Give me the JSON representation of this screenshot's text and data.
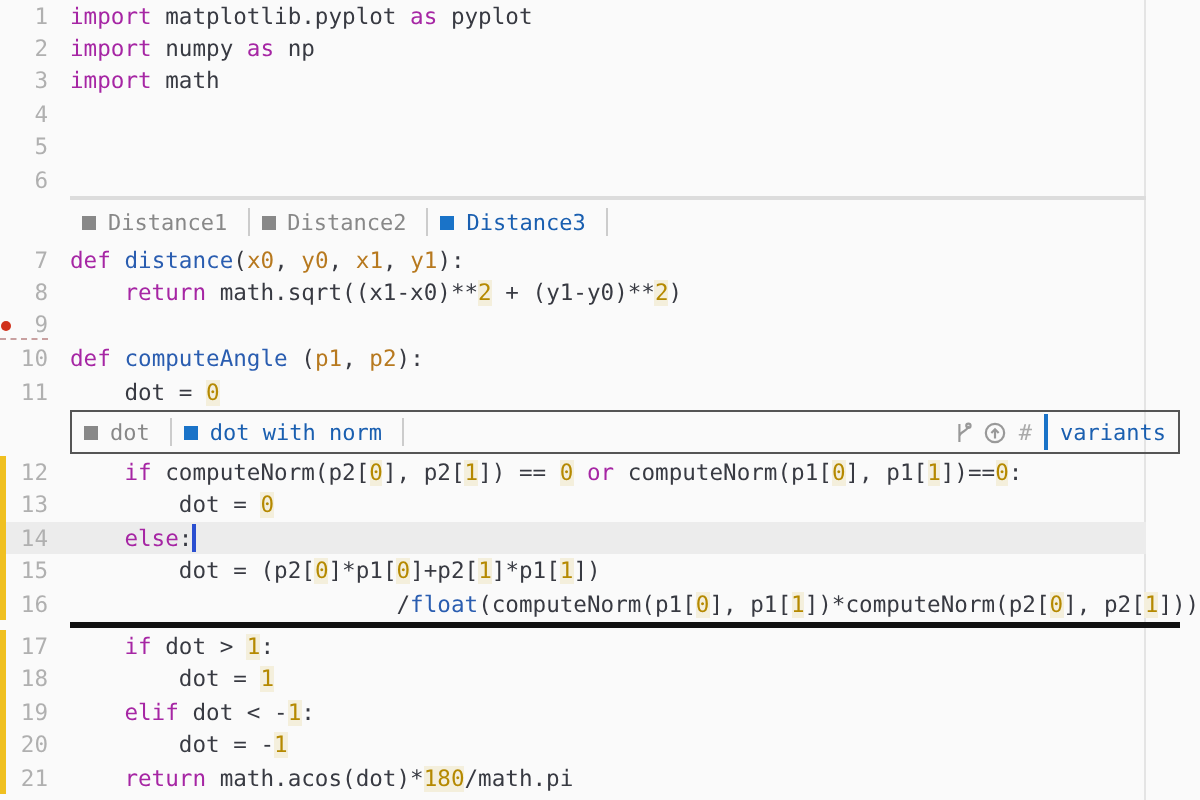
{
  "editor": {
    "blocks": [
      {
        "kind": "code",
        "lines": [
          {
            "number": "1",
            "changed": false,
            "current": false,
            "insertion": false,
            "tokens": [
              {
                "kind": "keyword",
                "text": "import"
              },
              {
                "kind": "plain",
                "text": " matplotlib.pyplot "
              },
              {
                "kind": "keyword",
                "text": "as"
              },
              {
                "kind": "plain",
                "text": " pyplot"
              }
            ]
          },
          {
            "number": "2",
            "changed": false,
            "current": false,
            "insertion": false,
            "tokens": [
              {
                "kind": "keyword",
                "text": "import"
              },
              {
                "kind": "plain",
                "text": " numpy "
              },
              {
                "kind": "keyword",
                "text": "as"
              },
              {
                "kind": "plain",
                "text": " np"
              }
            ]
          },
          {
            "number": "3",
            "changed": false,
            "current": false,
            "insertion": false,
            "tokens": [
              {
                "kind": "keyword",
                "text": "import"
              },
              {
                "kind": "plain",
                "text": " math"
              }
            ]
          },
          {
            "number": "4",
            "changed": false,
            "current": false,
            "insertion": false
          },
          {
            "number": "5",
            "changed": false,
            "current": false,
            "insertion": false
          },
          {
            "number": "6",
            "changed": false,
            "current": false,
            "insertion": false
          }
        ]
      },
      {
        "kind": "variant_bar",
        "bordered": false,
        "tabs": [
          {
            "label": "Distance1",
            "selected": false
          },
          {
            "label": "Distance2",
            "selected": false
          },
          {
            "label": "Distance3",
            "selected": true
          }
        ]
      },
      {
        "kind": "code",
        "lines": [
          {
            "number": "7",
            "changed": false,
            "current": false,
            "insertion": false,
            "tokens": [
              {
                "kind": "keyword",
                "text": "def "
              },
              {
                "kind": "function",
                "text": "distance"
              },
              {
                "kind": "plain",
                "text": "("
              },
              {
                "kind": "param",
                "text": "x0"
              },
              {
                "kind": "plain",
                "text": ", "
              },
              {
                "kind": "param",
                "text": "y0"
              },
              {
                "kind": "plain",
                "text": ", "
              },
              {
                "kind": "param",
                "text": "x1"
              },
              {
                "kind": "plain",
                "text": ", "
              },
              {
                "kind": "param",
                "text": "y1"
              },
              {
                "kind": "plain",
                "text": "):"
              }
            ]
          },
          {
            "number": "8",
            "changed": false,
            "current": false,
            "insertion": false,
            "tokens": [
              {
                "kind": "keyword",
                "text": "    return"
              },
              {
                "kind": "plain",
                "text": " math.sqrt((x1-x0)**"
              },
              {
                "kind": "number",
                "text": "2"
              },
              {
                "kind": "plain",
                "text": " + (y1-y0)**"
              },
              {
                "kind": "number",
                "text": "2"
              },
              {
                "kind": "plain",
                "text": ")"
              }
            ]
          },
          {
            "number": "9",
            "changed": false,
            "current": false,
            "insertion": true
          },
          {
            "number": "10",
            "changed": false,
            "current": false,
            "insertion": false,
            "tokens": [
              {
                "kind": "keyword",
                "text": "def "
              },
              {
                "kind": "function",
                "text": "computeAngle"
              },
              {
                "kind": "plain",
                "text": " ("
              },
              {
                "kind": "param",
                "text": "p1"
              },
              {
                "kind": "plain",
                "text": ", "
              },
              {
                "kind": "param",
                "text": "p2"
              },
              {
                "kind": "plain",
                "text": "):"
              }
            ]
          },
          {
            "number": "11",
            "changed": false,
            "current": false,
            "insertion": false,
            "tokens": [
              {
                "kind": "plain",
                "text": "    dot = "
              },
              {
                "kind": "number",
                "text": "0"
              }
            ]
          }
        ]
      },
      {
        "kind": "variant_bar",
        "bordered": true,
        "tabs": [
          {
            "label": "dot",
            "selected": false
          },
          {
            "label": "dot with norm",
            "selected": true
          }
        ],
        "hash": "#",
        "button": "variants"
      },
      {
        "kind": "code",
        "lines": [
          {
            "number": "12",
            "changed": true,
            "current": false,
            "insertion": false,
            "tokens": [
              {
                "kind": "keyword",
                "text": "    if"
              },
              {
                "kind": "plain",
                "text": " computeNorm(p2["
              },
              {
                "kind": "number",
                "text": "0"
              },
              {
                "kind": "plain",
                "text": "], p2["
              },
              {
                "kind": "number",
                "text": "1"
              },
              {
                "kind": "plain",
                "text": "]) == "
              },
              {
                "kind": "number",
                "text": "0"
              },
              {
                "kind": "keyword",
                "text": " or"
              },
              {
                "kind": "plain",
                "text": " computeNorm(p1["
              },
              {
                "kind": "number",
                "text": "0"
              },
              {
                "kind": "plain",
                "text": "], p1["
              },
              {
                "kind": "number",
                "text": "1"
              },
              {
                "kind": "plain",
                "text": "])=="
              },
              {
                "kind": "number",
                "text": "0"
              },
              {
                "kind": "plain",
                "text": ":"
              }
            ]
          },
          {
            "number": "13",
            "changed": true,
            "current": false,
            "insertion": false,
            "tokens": [
              {
                "kind": "plain",
                "text": "        dot = "
              },
              {
                "kind": "number",
                "text": "0"
              }
            ]
          },
          {
            "number": "14",
            "changed": true,
            "current": true,
            "insertion": false,
            "tokens": [
              {
                "kind": "keyword",
                "text": "    else"
              },
              {
                "kind": "plain",
                "text": ":"
              }
            ]
          },
          {
            "number": "15",
            "changed": true,
            "current": false,
            "insertion": false,
            "tokens": [
              {
                "kind": "plain",
                "text": "        dot = (p2["
              },
              {
                "kind": "number",
                "text": "0"
              },
              {
                "kind": "plain",
                "text": "]*p1["
              },
              {
                "kind": "number",
                "text": "0"
              },
              {
                "kind": "plain",
                "text": "]+p2["
              },
              {
                "kind": "number",
                "text": "1"
              },
              {
                "kind": "plain",
                "text": "]*p1["
              },
              {
                "kind": "number",
                "text": "1"
              },
              {
                "kind": "plain",
                "text": "])"
              }
            ]
          },
          {
            "number": "16",
            "changed": true,
            "current": false,
            "insertion": false,
            "tokens": [
              {
                "kind": "plain",
                "text": "                        /"
              },
              {
                "kind": "function",
                "text": "float"
              },
              {
                "kind": "plain",
                "text": "(computeNorm(p1["
              },
              {
                "kind": "number",
                "text": "0"
              },
              {
                "kind": "plain",
                "text": "], p1["
              },
              {
                "kind": "number",
                "text": "1"
              },
              {
                "kind": "plain",
                "text": "])*computeNorm(p2["
              },
              {
                "kind": "number",
                "text": "0"
              },
              {
                "kind": "plain",
                "text": "], p2["
              },
              {
                "kind": "number",
                "text": "1"
              },
              {
                "kind": "plain",
                "text": "]))"
              }
            ]
          }
        ]
      },
      {
        "kind": "divider"
      },
      {
        "kind": "code",
        "lines": [
          {
            "number": "17",
            "changed": true,
            "current": false,
            "insertion": false,
            "tokens": [
              {
                "kind": "keyword",
                "text": "    if"
              },
              {
                "kind": "plain",
                "text": " dot > "
              },
              {
                "kind": "number",
                "text": "1"
              },
              {
                "kind": "plain",
                "text": ":"
              }
            ]
          },
          {
            "number": "18",
            "changed": true,
            "current": false,
            "insertion": false,
            "tokens": [
              {
                "kind": "plain",
                "text": "        dot = "
              },
              {
                "kind": "number",
                "text": "1"
              }
            ]
          },
          {
            "number": "19",
            "changed": true,
            "current": false,
            "insertion": false,
            "tokens": [
              {
                "kind": "keyword",
                "text": "    elif"
              },
              {
                "kind": "plain",
                "text": " dot < -"
              },
              {
                "kind": "number",
                "text": "1"
              },
              {
                "kind": "plain",
                "text": ":"
              }
            ]
          },
          {
            "number": "20",
            "changed": true,
            "current": false,
            "insertion": false,
            "tokens": [
              {
                "kind": "plain",
                "text": "        dot = -"
              },
              {
                "kind": "number",
                "text": "1"
              }
            ]
          },
          {
            "number": "21",
            "changed": true,
            "current": false,
            "insertion": false,
            "tokens": [
              {
                "kind": "keyword",
                "text": "    return"
              },
              {
                "kind": "plain",
                "text": " math.acos(dot)*"
              },
              {
                "kind": "number",
                "text": "180"
              },
              {
                "kind": "plain",
                "text": "/math.pi"
              }
            ]
          }
        ]
      }
    ]
  }
}
